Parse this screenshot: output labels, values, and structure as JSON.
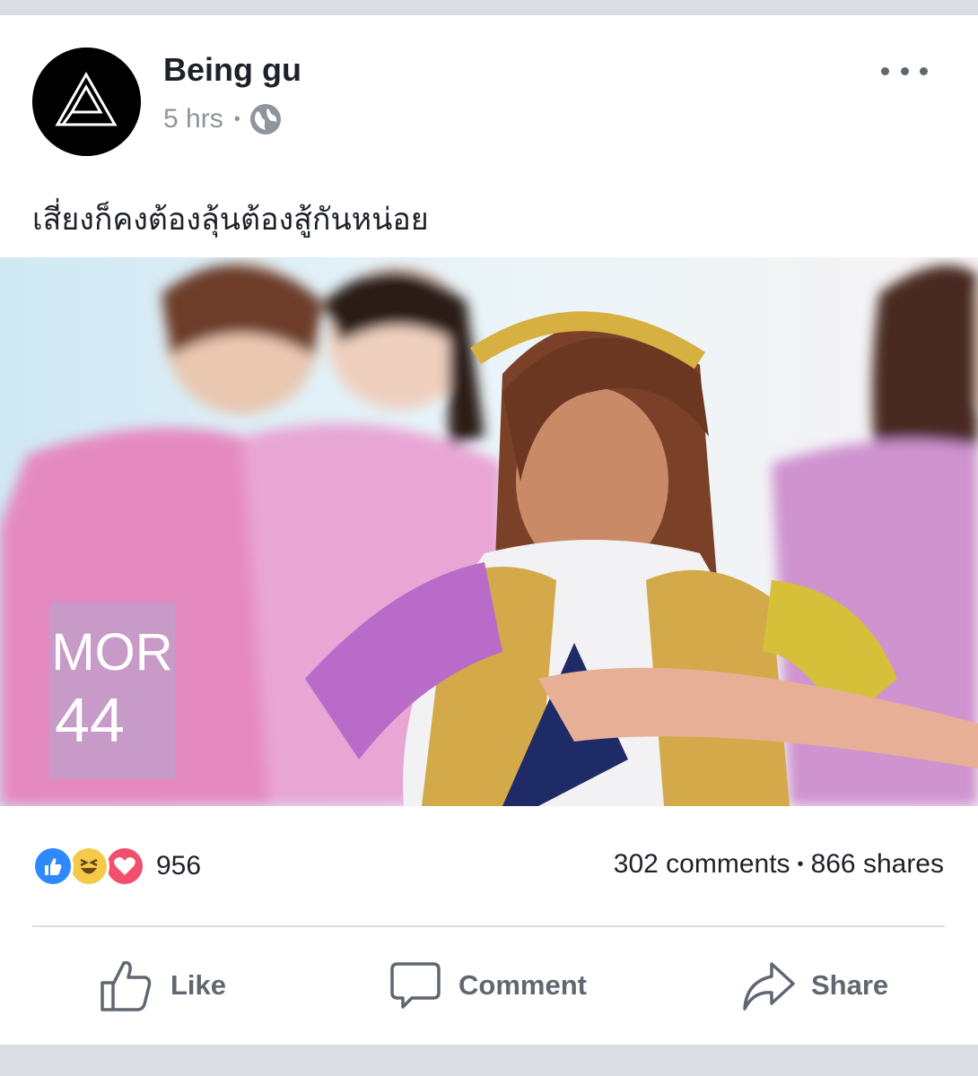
{
  "post": {
    "author": "Being gu",
    "time": "5 hrs",
    "separator": "•",
    "text": "เสี่ยงก็คงต้องลุ้นต้องสู้กันหน่อย",
    "photo_logo": {
      "line1": "MOR",
      "line2": "44",
      "color": "#c79ac8"
    }
  },
  "reactions": {
    "types": [
      "like-icon",
      "haha-icon",
      "love-icon"
    ],
    "count": "956"
  },
  "stats": {
    "comments": "302 comments",
    "separator": "•",
    "shares": "866 shares"
  },
  "actions": {
    "like": "Like",
    "comment": "Comment",
    "share": "Share"
  },
  "colors": {
    "like_blue": "#2e89ff",
    "haha_yellow": "#f7c948",
    "love_red": "#f0506e",
    "text": "#1d2129",
    "muted": "#606770"
  }
}
